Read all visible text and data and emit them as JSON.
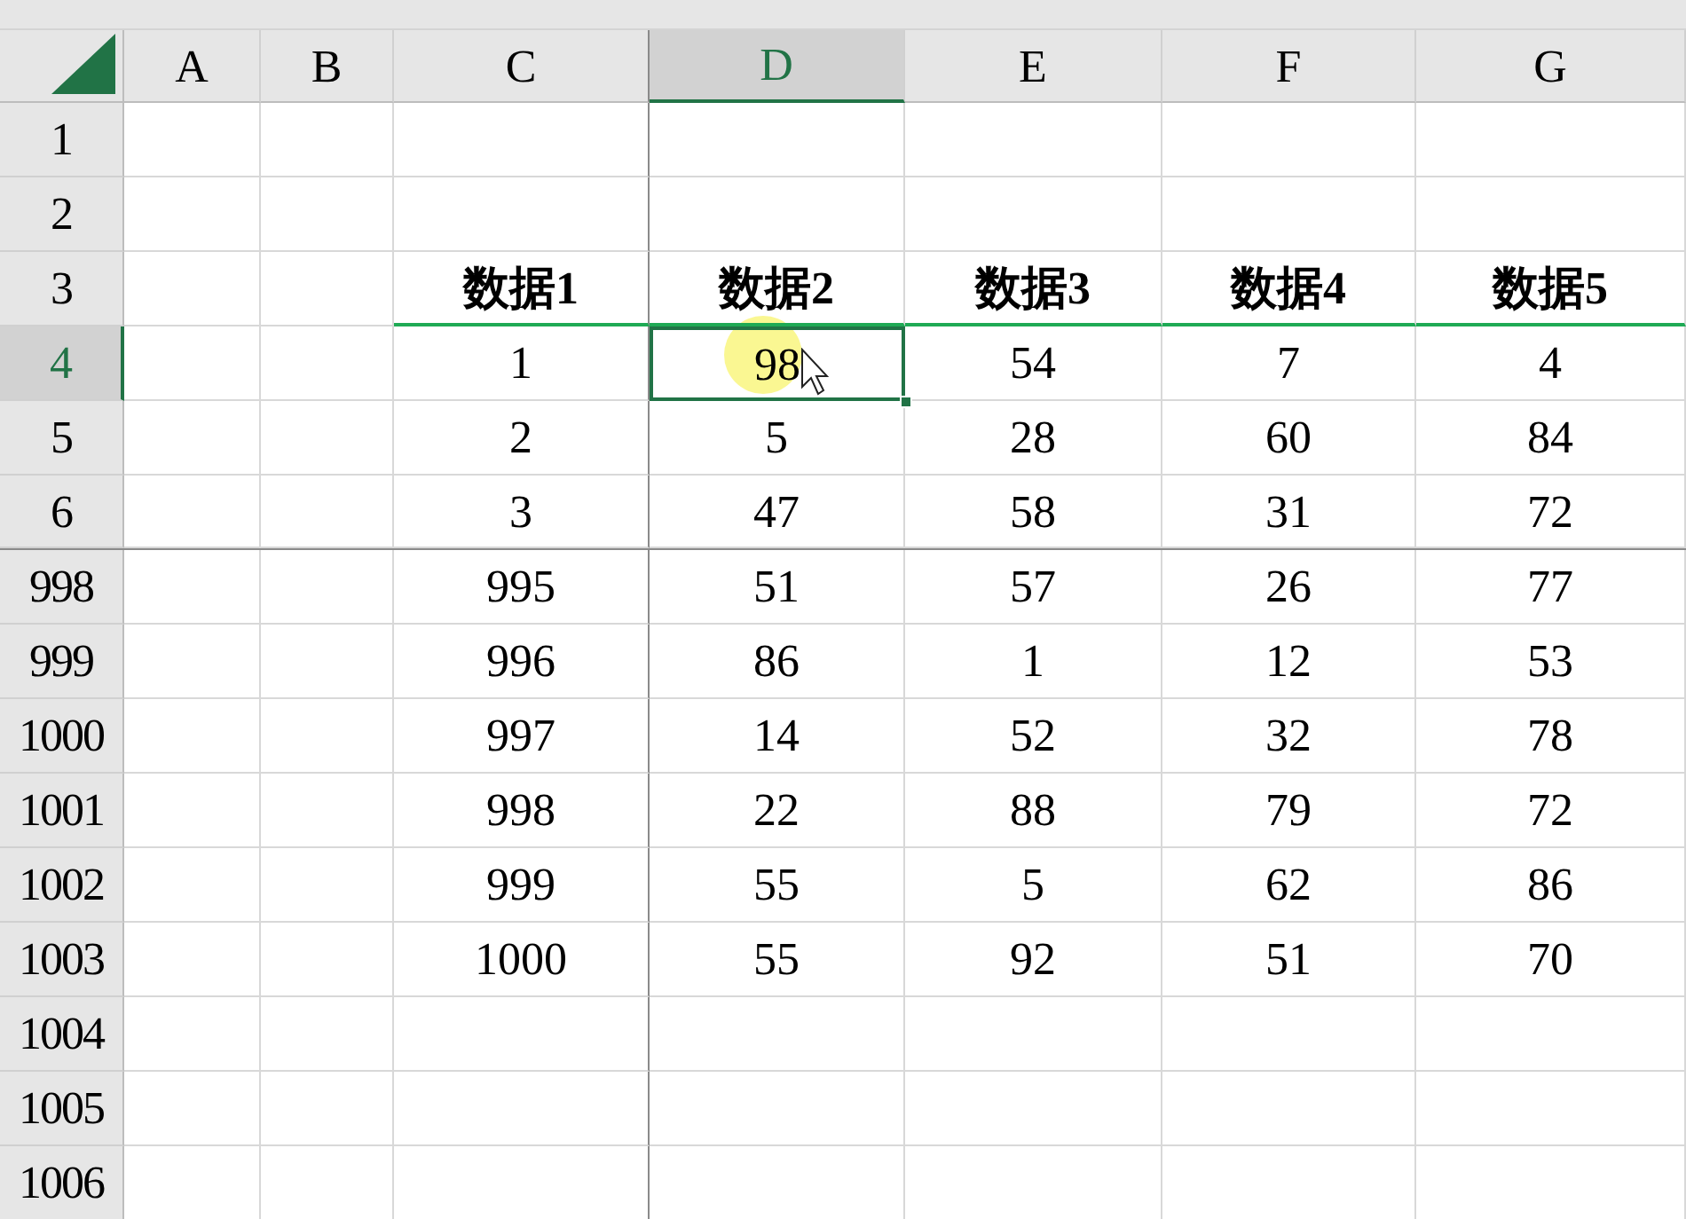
{
  "columns": [
    {
      "label": "A",
      "selected": false,
      "frozen_after": false
    },
    {
      "label": "B",
      "selected": false,
      "frozen_after": false
    },
    {
      "label": "C",
      "selected": false,
      "frozen_after": true
    },
    {
      "label": "D",
      "selected": true,
      "frozen_after": false
    },
    {
      "label": "E",
      "selected": false,
      "frozen_after": false
    },
    {
      "label": "F",
      "selected": false,
      "frozen_after": false
    },
    {
      "label": "G",
      "selected": false,
      "frozen_after": false
    }
  ],
  "rows": [
    {
      "label": "1",
      "selected": false,
      "frozen_after": false,
      "kind": "empty"
    },
    {
      "label": "2",
      "selected": false,
      "frozen_after": false,
      "kind": "empty"
    },
    {
      "label": "3",
      "selected": false,
      "frozen_after": false,
      "kind": "header",
      "values": [
        {
          "text": "数据1",
          "selected": false
        },
        {
          "text": "数据2",
          "selected": false
        },
        {
          "text": "数据3",
          "selected": false
        },
        {
          "text": "数据4",
          "selected": false
        },
        {
          "text": "数据5",
          "selected": false
        }
      ]
    },
    {
      "label": "4",
      "selected": true,
      "frozen_after": false,
      "kind": "data",
      "values": [
        {
          "text": "1",
          "selected": false
        },
        {
          "text": "98",
          "selected": true
        },
        {
          "text": "54",
          "selected": false
        },
        {
          "text": "7",
          "selected": false
        },
        {
          "text": "4",
          "selected": false
        }
      ]
    },
    {
      "label": "5",
      "selected": false,
      "frozen_after": false,
      "kind": "data",
      "values": [
        {
          "text": "2",
          "selected": false
        },
        {
          "text": "5",
          "selected": false
        },
        {
          "text": "28",
          "selected": false
        },
        {
          "text": "60",
          "selected": false
        },
        {
          "text": "84",
          "selected": false
        }
      ]
    },
    {
      "label": "6",
      "selected": false,
      "frozen_after": true,
      "kind": "data",
      "values": [
        {
          "text": "3",
          "selected": false
        },
        {
          "text": "47",
          "selected": false
        },
        {
          "text": "58",
          "selected": false
        },
        {
          "text": "31",
          "selected": false
        },
        {
          "text": "72",
          "selected": false
        }
      ]
    },
    {
      "label": "998",
      "selected": false,
      "frozen_after": false,
      "kind": "data",
      "values": [
        {
          "text": "995",
          "selected": false
        },
        {
          "text": "51",
          "selected": false
        },
        {
          "text": "57",
          "selected": false
        },
        {
          "text": "26",
          "selected": false
        },
        {
          "text": "77",
          "selected": false
        }
      ]
    },
    {
      "label": "999",
      "selected": false,
      "frozen_after": false,
      "kind": "data",
      "values": [
        {
          "text": "996",
          "selected": false
        },
        {
          "text": "86",
          "selected": false
        },
        {
          "text": "1",
          "selected": false
        },
        {
          "text": "12",
          "selected": false
        },
        {
          "text": "53",
          "selected": false
        }
      ]
    },
    {
      "label": "1000",
      "selected": false,
      "frozen_after": false,
      "kind": "data",
      "values": [
        {
          "text": "997",
          "selected": false
        },
        {
          "text": "14",
          "selected": false
        },
        {
          "text": "52",
          "selected": false
        },
        {
          "text": "32",
          "selected": false
        },
        {
          "text": "78",
          "selected": false
        }
      ]
    },
    {
      "label": "1001",
      "selected": false,
      "frozen_after": false,
      "kind": "data",
      "values": [
        {
          "text": "998",
          "selected": false
        },
        {
          "text": "22",
          "selected": false
        },
        {
          "text": "88",
          "selected": false
        },
        {
          "text": "79",
          "selected": false
        },
        {
          "text": "72",
          "selected": false
        }
      ]
    },
    {
      "label": "1002",
      "selected": false,
      "frozen_after": false,
      "kind": "data",
      "values": [
        {
          "text": "999",
          "selected": false
        },
        {
          "text": "55",
          "selected": false
        },
        {
          "text": "5",
          "selected": false
        },
        {
          "text": "62",
          "selected": false
        },
        {
          "text": "86",
          "selected": false
        }
      ]
    },
    {
      "label": "1003",
      "selected": false,
      "frozen_after": false,
      "kind": "data",
      "values": [
        {
          "text": "1000",
          "selected": false
        },
        {
          "text": "55",
          "selected": false
        },
        {
          "text": "92",
          "selected": false
        },
        {
          "text": "51",
          "selected": false
        },
        {
          "text": "70",
          "selected": false
        }
      ]
    },
    {
      "label": "1004",
      "selected": false,
      "frozen_after": false,
      "kind": "empty"
    },
    {
      "label": "1005",
      "selected": false,
      "frozen_after": false,
      "kind": "empty"
    },
    {
      "label": "1006",
      "selected": false,
      "frozen_after": false,
      "kind": "empty"
    }
  ]
}
